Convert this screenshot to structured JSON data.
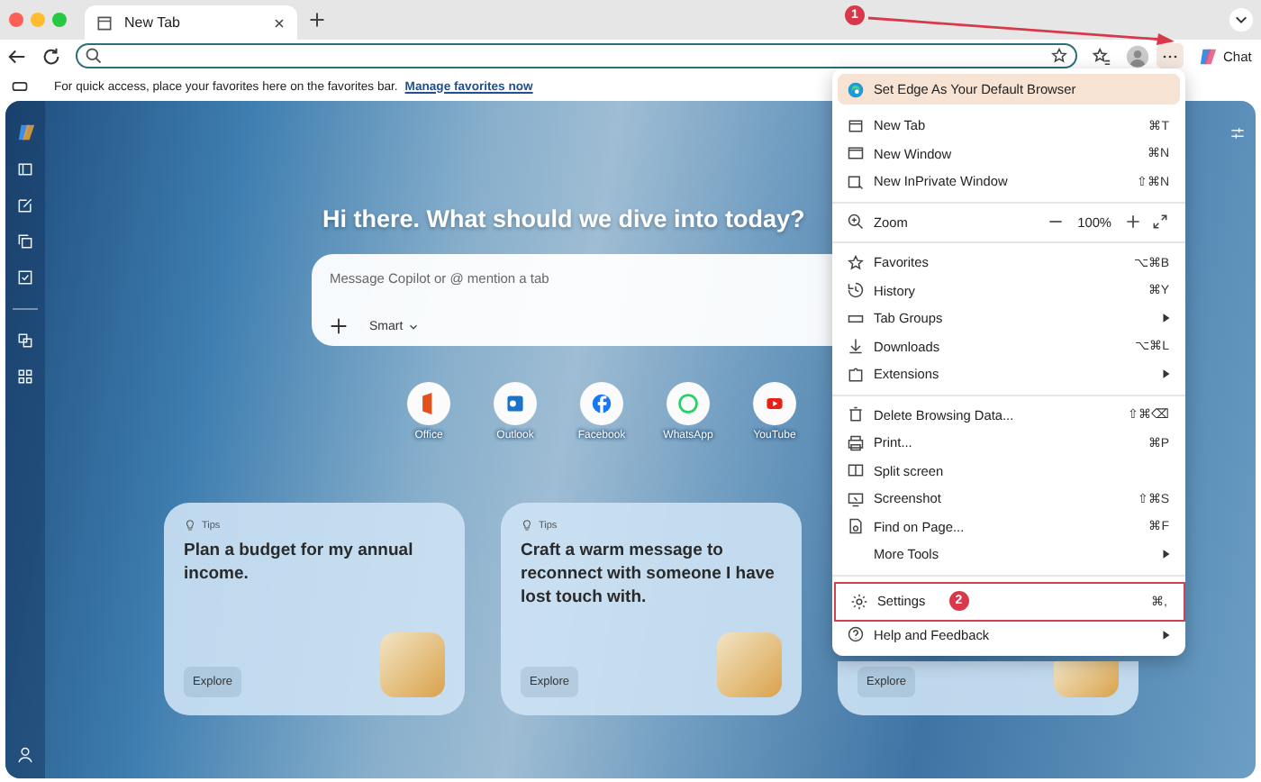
{
  "browser_tab": {
    "title": "New Tab"
  },
  "callout": {
    "label": "1"
  },
  "toolbar": {
    "chat_label": "Chat"
  },
  "favorites_bar": {
    "message": "For quick access, place your favorites here on the favorites bar.",
    "link": "Manage favorites now"
  },
  "new_tab_page": {
    "greeting": "Hi there. What should we dive into today?",
    "composer": {
      "placeholder": "Message Copilot or @ mention a tab",
      "mode": "Smart"
    },
    "quick_links": [
      {
        "label": "Office"
      },
      {
        "label": "Outlook"
      },
      {
        "label": "Facebook"
      },
      {
        "label": "WhatsApp"
      },
      {
        "label": "YouTube"
      }
    ],
    "tip_cards": [
      {
        "tag": "Tips",
        "text": "Plan a budget for my annual income.",
        "button": "Explore"
      },
      {
        "tag": "Tips",
        "text": "Craft a warm message to reconnect with someone I have lost touch with.",
        "button": "Explore"
      },
      {
        "button": "Explore"
      }
    ]
  },
  "menu": {
    "promo": "Set Edge As Your Default Browser",
    "sections": [
      [
        {
          "kind": "command",
          "label": "New Tab",
          "shortcut": "⌘T",
          "submenu": false,
          "outlined": false
        },
        {
          "kind": "command",
          "label": "New Window",
          "shortcut": "⌘N",
          "submenu": false,
          "outlined": false
        },
        {
          "kind": "command",
          "label": "New InPrivate Window",
          "shortcut": "⇧⌘N",
          "submenu": false,
          "outlined": false
        }
      ],
      [
        {
          "kind": "zoom",
          "label": "Zoom",
          "value": "100%",
          "submenu": false,
          "outlined": false
        }
      ],
      [
        {
          "kind": "command",
          "label": "Favorites",
          "shortcut": "⌥⌘B",
          "submenu": false,
          "outlined": false
        },
        {
          "kind": "command",
          "label": "History",
          "shortcut": "⌘Y",
          "submenu": false,
          "outlined": false
        },
        {
          "kind": "command",
          "label": "Tab Groups",
          "submenu": true,
          "outlined": false
        },
        {
          "kind": "command",
          "label": "Downloads",
          "shortcut": "⌥⌘L",
          "submenu": false,
          "outlined": false
        },
        {
          "kind": "command",
          "label": "Extensions",
          "submenu": true,
          "outlined": false
        }
      ],
      [
        {
          "kind": "command",
          "label": "Delete Browsing Data...",
          "shortcut": "⇧⌘⌫",
          "submenu": false,
          "outlined": false
        },
        {
          "kind": "command",
          "label": "Print...",
          "shortcut": "⌘P",
          "submenu": false,
          "outlined": false
        },
        {
          "kind": "command",
          "label": "Split screen",
          "submenu": false,
          "outlined": false
        },
        {
          "kind": "command",
          "label": "Screenshot",
          "shortcut": "⇧⌘S",
          "submenu": false,
          "outlined": false
        },
        {
          "kind": "command",
          "label": "Find on Page...",
          "shortcut": "⌘F",
          "submenu": false,
          "outlined": false
        },
        {
          "kind": "command",
          "label": "More Tools",
          "submenu": true,
          "outlined": false
        }
      ],
      [
        {
          "kind": "command",
          "label": "Settings",
          "shortcut": "⌘,",
          "badge": "2",
          "submenu": false,
          "outlined": true
        },
        {
          "kind": "command",
          "label": "Help and Feedback",
          "submenu": true,
          "outlined": false
        }
      ]
    ]
  }
}
